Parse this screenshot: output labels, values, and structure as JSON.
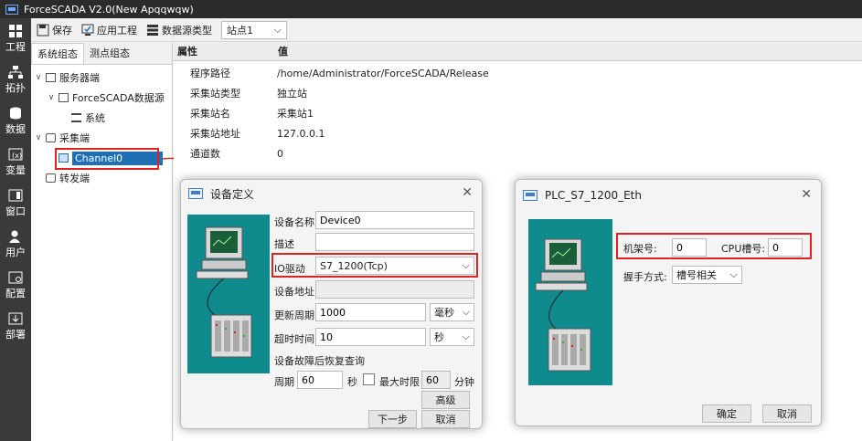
{
  "window": {
    "title": "ForceSCADA V2.0(New Apqqwqw)"
  },
  "nav": [
    {
      "label": "工程",
      "icon": "grid-icon"
    },
    {
      "label": "拓扑",
      "icon": "topology-icon"
    },
    {
      "label": "数据",
      "icon": "database-icon"
    },
    {
      "label": "变量",
      "icon": "variable-icon"
    },
    {
      "label": "窗口",
      "icon": "window-icon"
    },
    {
      "label": "用户",
      "icon": "user-icon"
    },
    {
      "label": "配置",
      "icon": "config-icon"
    },
    {
      "label": "部署",
      "icon": "deploy-icon"
    }
  ],
  "toolbar": {
    "save": "保存",
    "apply": "应用工程",
    "datasource": "数据源类型",
    "station": "站点1"
  },
  "sidebar": {
    "tabs": [
      "系统组态",
      "测点组态"
    ],
    "tree": [
      {
        "label": "服务器端",
        "level": 0,
        "expanded": true
      },
      {
        "label": "ForceSCADA数据源",
        "level": 1,
        "expanded": true
      },
      {
        "label": "系统",
        "level": 2
      },
      {
        "label": "采集端",
        "level": 0,
        "expanded": true
      },
      {
        "label": "Channel0",
        "level": 1,
        "selected": true
      },
      {
        "label": "转发端",
        "level": 0
      }
    ]
  },
  "props": {
    "headers": [
      "属性",
      "值"
    ],
    "rows": [
      {
        "k": "程序路径",
        "v": "/home/Administrator/ForceSCADA/Release"
      },
      {
        "k": "采集站类型",
        "v": "独立站"
      },
      {
        "k": "采集站名",
        "v": "采集站1"
      },
      {
        "k": "采集站地址",
        "v": "127.0.0.1"
      },
      {
        "k": "通道数",
        "v": "0"
      }
    ]
  },
  "device_dialog": {
    "title": "设备定义",
    "name_label": "设备名称",
    "name_value": "Device0",
    "desc_label": "描述",
    "desc_value": "",
    "io_label": "IO驱动",
    "io_value": "S7_1200(Tcp)",
    "addr_label": "设备地址",
    "addr_value": "",
    "period_label": "更新周期",
    "period_value": "1000",
    "period_unit": "毫秒",
    "timeout_label": "超时时间",
    "timeout_value": "10",
    "timeout_unit": "秒",
    "recovery_label": "设备故障后恢复查询",
    "cycle_label": "周期",
    "cycle_value": "60",
    "cycle_unit": "秒",
    "maxlimit_label": "最大时限",
    "maxlimit_value": "60",
    "maxlimit_unit": "分钟",
    "advanced": "高级",
    "next": "下一步",
    "cancel": "取消"
  },
  "plc_dialog": {
    "title": "PLC_S7_1200_Eth",
    "rack_label": "机架号:",
    "rack_value": "0",
    "slot_label": "CPU槽号:",
    "slot_value": "0",
    "handshake_label": "握手方式:",
    "handshake_value": "槽号相关",
    "ok": "确定",
    "cancel": "取消"
  },
  "colors": {
    "accent": "#1f6fb5",
    "highlight": "#dd2222",
    "illustration": "#0f8b8d"
  }
}
